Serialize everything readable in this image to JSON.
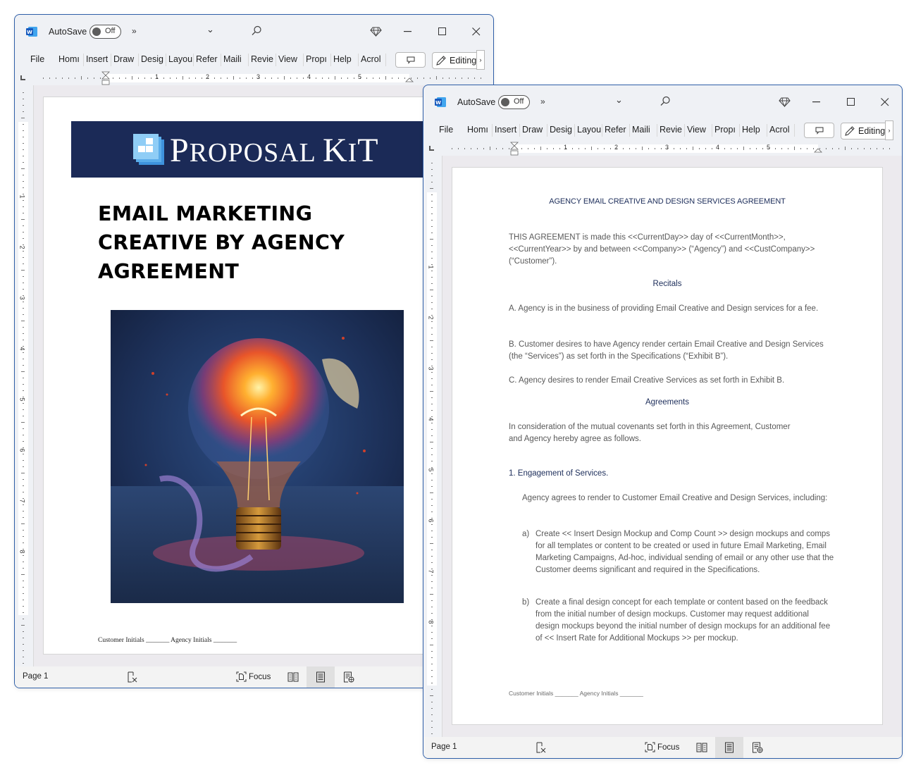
{
  "windows": [
    {
      "id": "left",
      "app": "Word",
      "titlebar": {
        "autosave_label": "AutoSave",
        "autosave_state": "Off",
        "more_label": "»"
      },
      "ribbon_tabs": [
        "File",
        "Homı",
        "Insert",
        "Draw",
        "Desig",
        "Layou",
        "Refer",
        "Maili",
        "Revie",
        "View",
        "Propı",
        "Help",
        "Acrol"
      ],
      "editing_label": "Editing",
      "ruler_numbers": [
        "1",
        "2",
        "3",
        "4",
        "5"
      ],
      "vruler_numbers": [
        "1",
        "2",
        "3",
        "4",
        "5",
        "6",
        "7",
        "8"
      ],
      "status": {
        "page": "Page 1",
        "focus_label": "Focus"
      },
      "document": {
        "banner_brand": "PROPOSAL KIT",
        "banner_brand_parts": [
          {
            "text": "P",
            "size": "big"
          },
          {
            "text": "ROPOSAL ",
            "size": "small"
          },
          {
            "text": "K",
            "size": "big"
          },
          {
            "text": "I",
            "size": "small"
          },
          {
            "text": "T",
            "size": "small"
          }
        ],
        "title_lines": [
          "EMAIL MARKETING",
          "CREATIVE BY AGENCY",
          "AGREEMENT"
        ],
        "cover_image_alt": "Glowing light bulb with colorful paint splash",
        "initials": "Customer Initials  _______ Agency Initials _______"
      }
    },
    {
      "id": "right",
      "app": "Word",
      "titlebar": {
        "autosave_label": "AutoSave",
        "autosave_state": "Off",
        "more_label": "»"
      },
      "ribbon_tabs": [
        "File",
        "Homı",
        "Insert",
        "Draw",
        "Desig",
        "Layou",
        "Refer",
        "Maili",
        "Revie",
        "View",
        "Propı",
        "Help",
        "Acrol"
      ],
      "editing_label": "Editing",
      "ruler_numbers": [
        "1",
        "2",
        "3",
        "4",
        "5"
      ],
      "vruler_numbers": [
        "1",
        "2",
        "3",
        "4",
        "5",
        "6",
        "7",
        "8"
      ],
      "status": {
        "page": "Page 1",
        "focus_label": "Focus"
      },
      "document": {
        "title": "AGENCY EMAIL CREATIVE AND DESIGN SERVICES AGREEMENT",
        "intro": "THIS AGREEMENT is made this <<CurrentDay>> day of <<CurrentMonth>>, <<CurrentYear>> by and between <<Company>> (“Agency”) and <<CustCompany>> (“Customer”).",
        "recitals_heading": "Recitals",
        "recital_a": "A. Agency is in the business of providing Email Creative and Design services for a fee.",
        "recital_b": "B. Customer desires to have Agency render certain Email Creative and Design Services (the “Services”) as set forth in the Specifications (“Exhibit B”).",
        "recital_c": "C. Agency desires to render Email Creative Services as set forth in Exhibit B.",
        "agreements_heading": "Agreements",
        "consideration": "In consideration of the mutual covenants set forth in this Agreement, Customer and Agency hereby agree as follows.",
        "section1_heading": "1. Engagement of Services.",
        "section1_intro": "Agency agrees to render to Customer Email Creative and Design Services, including:",
        "items": [
          {
            "marker": "a)",
            "text": "Create << Insert Design Mockup and Comp Count >> design mockups and comps for all templates or content to be created or used in future Email Marketing, Email Marketing Campaigns, Ad-hoc, individual sending of email or any other use that the Customer deems significant and required in the Specifications."
          },
          {
            "marker": "b)",
            "text": "Create a final design concept for each template or content based on the feedback from the initial number of design mockups. Customer may request additional design mockups beyond the initial number of design mockups for an additional fee of  << Insert Rate for Additional Mockups >> per mockup."
          }
        ],
        "initials": "Customer Initials  _______ Agency Initials _______"
      }
    }
  ],
  "colors": {
    "window_border": "#2f5fa8",
    "chrome_bg": "#eff1f5",
    "doc_bg": "#eceaee",
    "banner_navy": "#1b2a57",
    "heading_navy": "#1c2d5a",
    "word_blue": "#185abd"
  }
}
